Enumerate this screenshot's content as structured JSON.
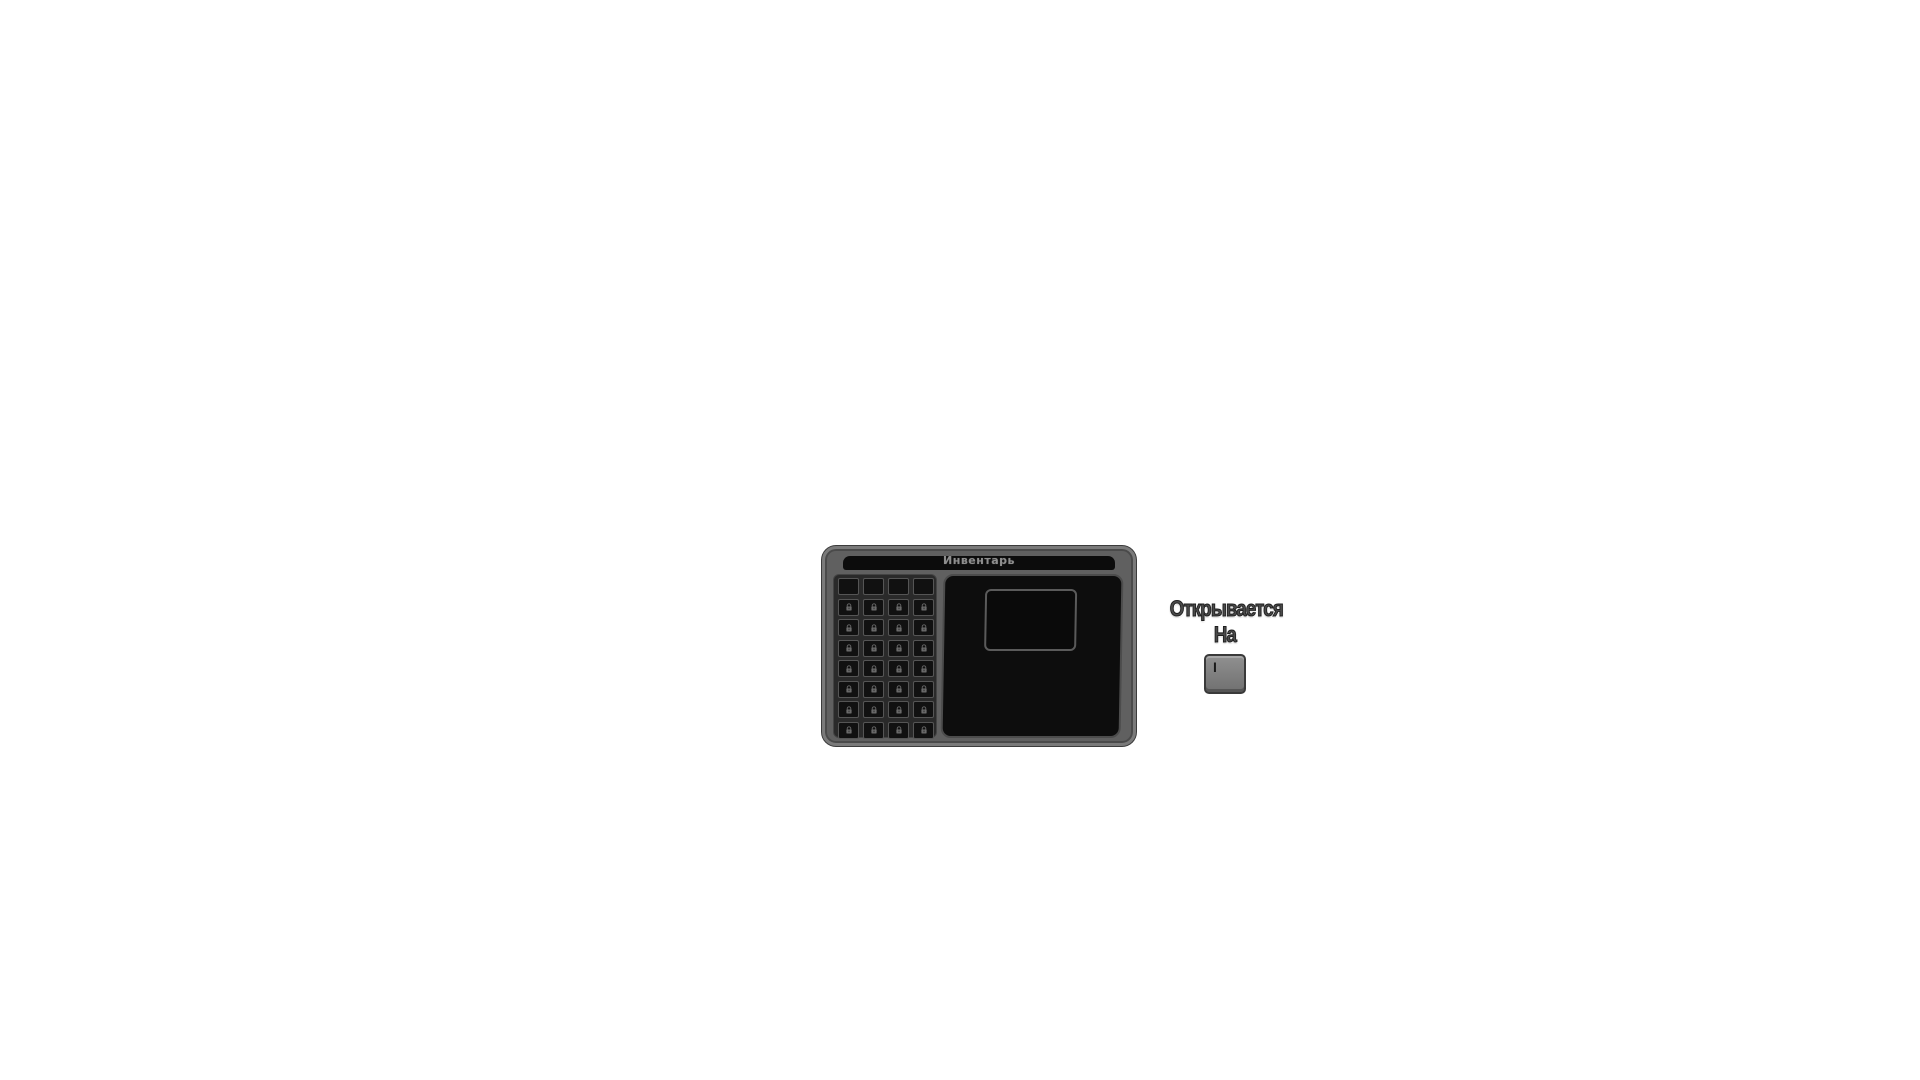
{
  "inventory": {
    "title": "Инвентарь",
    "slots": {
      "columns": 4,
      "rows": 8,
      "unlocked_rows": 1
    },
    "icons": {
      "locked_slot": "lock-icon"
    }
  },
  "hint": {
    "line1": "Открывается",
    "line2": "На",
    "key": "I"
  },
  "colors": {
    "panel": "#606060",
    "panel_dark": "#0d0d0d",
    "slot": "#111111"
  }
}
